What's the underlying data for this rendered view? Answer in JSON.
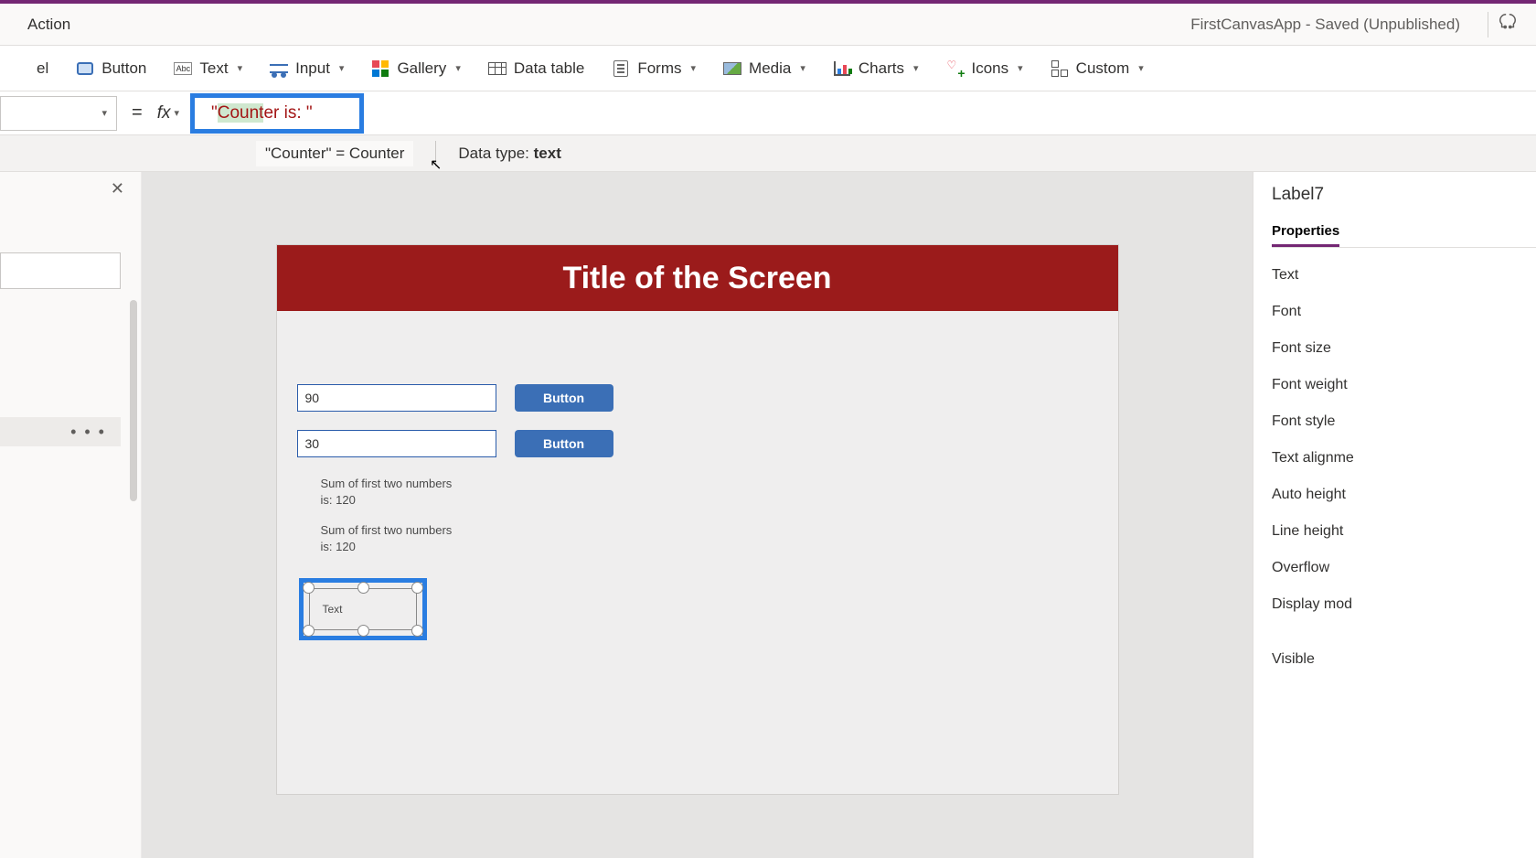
{
  "titlebar": {
    "tab": "Action",
    "status": "FirstCanvasApp - Saved (Unpublished)"
  },
  "ribbon": {
    "label_suffix": "el",
    "button": "Button",
    "text": "Text",
    "input": "Input",
    "gallery": "Gallery",
    "datatable": "Data table",
    "forms": "Forms",
    "media": "Media",
    "charts": "Charts",
    "icons": "Icons",
    "custom": "Custom"
  },
  "formula": {
    "equals": "=",
    "fx": "fx",
    "value_quote_open": "\"",
    "value_highlighted": "Count",
    "value_rest": "er is: ",
    "value_quote_close": "\"",
    "hint_left": "\"Counter\"  =  Counter",
    "hint_right_label": "Data type: ",
    "hint_right_value": "text"
  },
  "tree": {
    "selected_more": "• • •"
  },
  "canvas": {
    "title": "Title of the Screen",
    "input1": "90",
    "input2": "30",
    "button1": "Button",
    "button2": "Button",
    "sum1": "Sum of first two numbers is: 120",
    "sum2": "Sum of first two numbers is: 120",
    "selected_label_text": "Text"
  },
  "properties": {
    "control_name": "Label7",
    "tab_properties": "Properties",
    "items": [
      "Text",
      "Font",
      "Font size",
      "Font weight",
      "Font style",
      "Text alignme",
      "Auto height",
      "Line height",
      "Overflow",
      "Display mod"
    ],
    "visible": "Visible"
  }
}
